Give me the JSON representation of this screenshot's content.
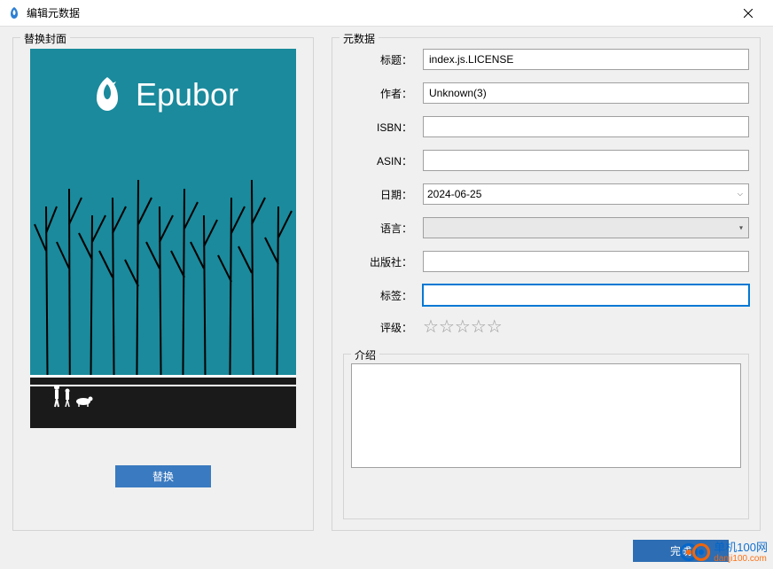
{
  "window": {
    "title": "编辑元数据"
  },
  "coverPanel": {
    "legend": "替换封面",
    "logoText": "Epubor",
    "replaceButton": "替换"
  },
  "metadataPanel": {
    "legend": "元数据",
    "fields": {
      "title": {
        "label": "标题：",
        "value": "index.js.LICENSE"
      },
      "author": {
        "label": "作者：",
        "value": "Unknown(3)"
      },
      "isbn": {
        "label": "ISBN：",
        "value": ""
      },
      "asin": {
        "label": "ASIN：",
        "value": ""
      },
      "date": {
        "label": "日期：",
        "value": "2024-06-25"
      },
      "language": {
        "label": "语言：",
        "value": ""
      },
      "publisher": {
        "label": "出版社：",
        "value": ""
      },
      "tags": {
        "label": "标签：",
        "value": ""
      },
      "rating": {
        "label": "评级：",
        "value": 0
      }
    }
  },
  "introPanel": {
    "legend": "介绍",
    "value": ""
  },
  "completeButton": "完成",
  "watermark": {
    "line1": "单机100网",
    "line2": "danji100.com"
  }
}
